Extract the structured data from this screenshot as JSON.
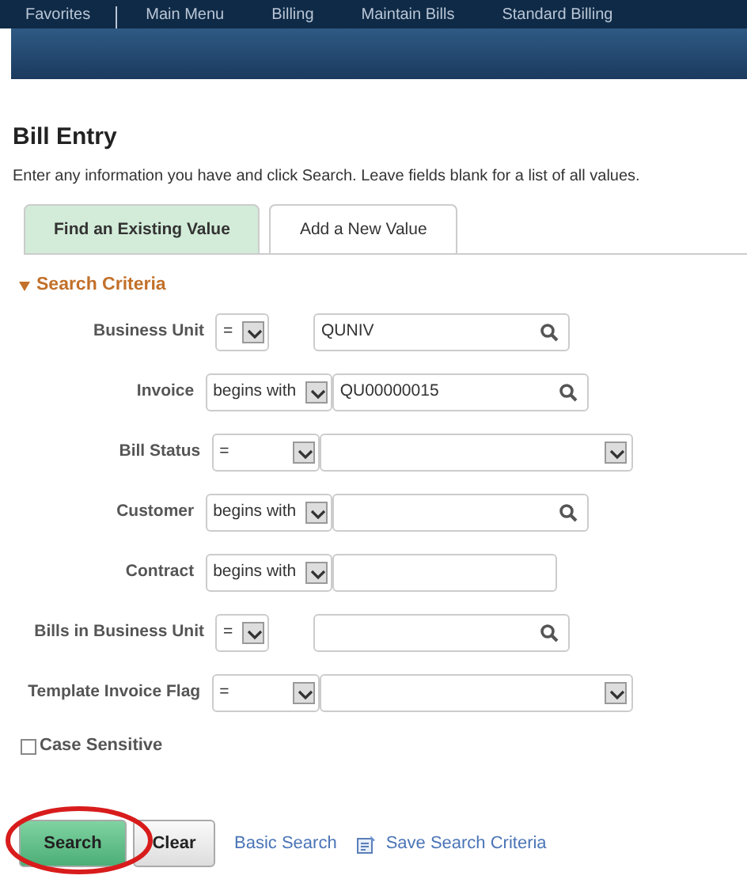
{
  "menu": [
    {
      "label": "Favorites"
    },
    {
      "label": "Main Menu"
    },
    {
      "label": "Billing"
    },
    {
      "label": "Maintain Bills"
    },
    {
      "label": "Standard Billing"
    }
  ],
  "title": "Bill Entry",
  "instructions": "Enter any information you have and click Search. Leave fields blank for a list of all values.",
  "tabs": [
    {
      "label": "Find an Existing Value",
      "selected": true
    },
    {
      "label": "Add a New Value",
      "selected": false
    }
  ],
  "section": {
    "label": "Search Criteria",
    "expanded": true
  },
  "criteria": [
    {
      "label": "Business Unit",
      "operator": {
        "text": "=",
        "kind": "short"
      },
      "field": {
        "kind": "lookup",
        "value": "QUNIV"
      }
    },
    {
      "label": "Invoice",
      "operator": {
        "text": "begins with",
        "kind": "long"
      },
      "field": {
        "kind": "lookup",
        "value": "QU00000015"
      }
    },
    {
      "label": "Bill Status",
      "operator": {
        "text": "=",
        "kind": "wide"
      },
      "field": {
        "kind": "dropdown"
      }
    },
    {
      "label": "Customer",
      "operator": {
        "text": "begins with",
        "kind": "long"
      },
      "field": {
        "kind": "lookup"
      }
    },
    {
      "label": "Contract",
      "operator": {
        "text": "begins with",
        "kind": "long"
      },
      "field": {
        "kind": "text"
      }
    },
    {
      "label": "Bills in Business Unit",
      "operator": {
        "text": "=",
        "kind": "short"
      },
      "field": {
        "kind": "lookup"
      }
    },
    {
      "label": "Template Invoice Flag",
      "operator": {
        "text": "=",
        "kind": "wide"
      },
      "field": {
        "kind": "dropdown"
      }
    }
  ],
  "case_sensitive": {
    "label": "Case Sensitive",
    "checked": false
  },
  "buttons": [
    {
      "label": "Search",
      "kind": "primary",
      "circled": true
    },
    {
      "label": "Clear",
      "kind": "secondary",
      "circled": false
    }
  ],
  "links": [
    {
      "label": "Basic Search",
      "kind": "plain"
    },
    {
      "label": "Save Search Criteria",
      "kind": "save"
    }
  ]
}
